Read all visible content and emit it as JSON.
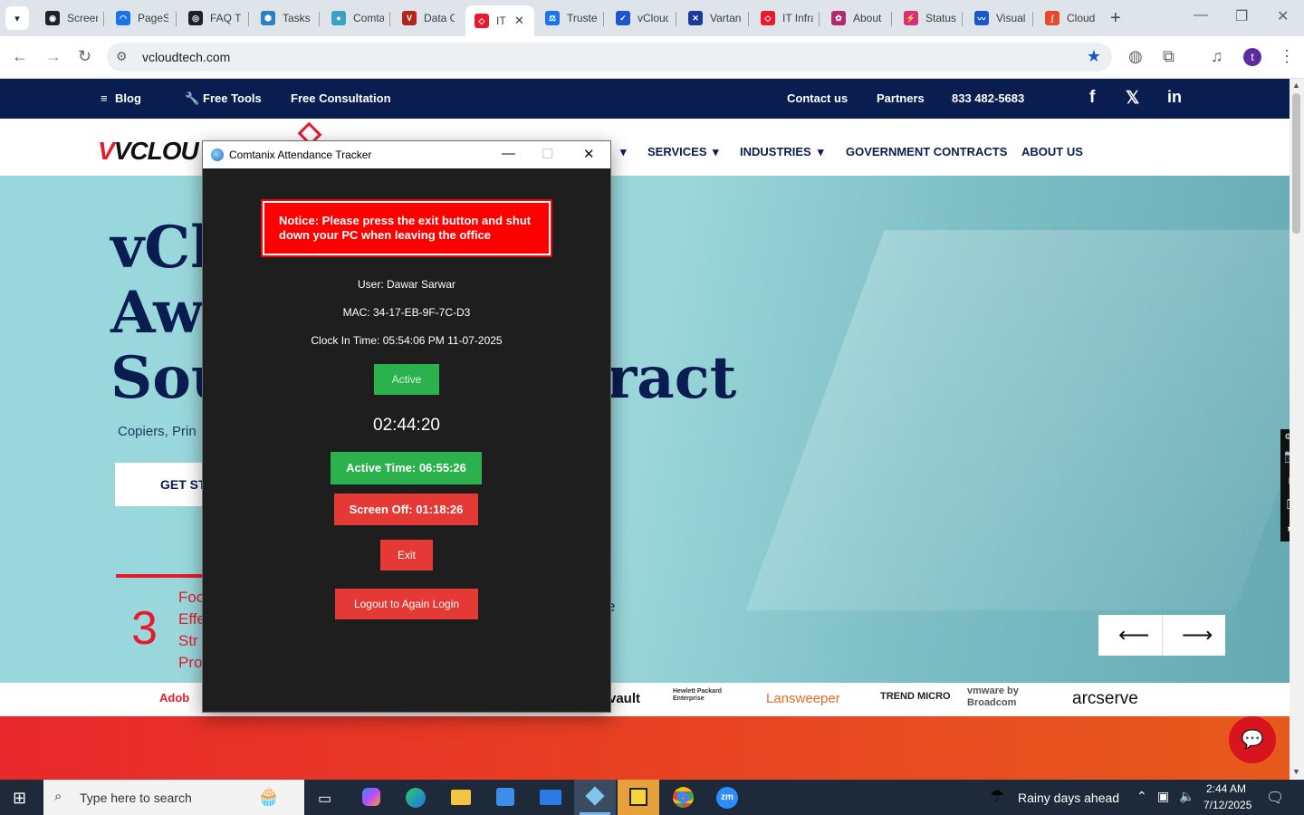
{
  "browser": {
    "tabs": [
      {
        "label": "Screen",
        "color": "#202124",
        "glyph": "◉"
      },
      {
        "label": "PageSpeed",
        "color": "#1a73e8",
        "glyph": "◠"
      },
      {
        "label": "FAQ T",
        "color": "#202124",
        "glyph": "◎"
      },
      {
        "label": "Tasks",
        "color": "#2b7fc3",
        "glyph": "⬢"
      },
      {
        "label": "Comtanix",
        "color": "#3aa0c8",
        "glyph": "●"
      },
      {
        "label": "Data C",
        "color": "#b3261e",
        "glyph": "V"
      },
      {
        "label": "IT",
        "color": "#e8192c",
        "glyph": "◇",
        "active": true
      },
      {
        "label": "Truste",
        "color": "#1a73e8",
        "glyph": "⚖"
      },
      {
        "label": "vCloud",
        "color": "#1a57c9",
        "glyph": "✓"
      },
      {
        "label": "Vartan",
        "color": "#1a3a9e",
        "glyph": "✕"
      },
      {
        "label": "IT Infra",
        "color": "#e8192c",
        "glyph": "◇"
      },
      {
        "label": "About",
        "color": "#b0286e",
        "glyph": "✿"
      },
      {
        "label": "Status",
        "color": "#d62e7a",
        "glyph": "⚡"
      },
      {
        "label": "Visual",
        "color": "#1a57c9",
        "glyph": "〰"
      },
      {
        "label": "Cloud",
        "color": "#e8492a",
        "glyph": "∫"
      }
    ],
    "url": "vcloudtech.com",
    "profile_initial": "t"
  },
  "site": {
    "topbar": {
      "blog": "Blog",
      "free_tools": "Free Tools",
      "free_consultation": "Free Consultation",
      "contact": "Contact us",
      "partners": "Partners",
      "phone": "833 482-5683"
    },
    "logo": "VCLOU",
    "nav": {
      "services": "SERVICES",
      "industries": "INDUSTRIES",
      "government": "GOVERNMENT CONTRACTS",
      "about": "ABOUT US"
    },
    "hero": {
      "line1": "vCl",
      "line2": "Aw",
      "line3a": "Sou",
      "line3b": "tract",
      "subtitle": "Copiers, Prin",
      "button": "GET ST",
      "stat_number": "3",
      "stat_lines": [
        "Foc",
        "Effe",
        "Str",
        "Pro"
      ],
      "stat_tail": "e"
    },
    "partner_logos": [
      "Adob",
      "vault",
      "Hewlett Packard Enterprise",
      "Lansweeper",
      "TREND MICRO",
      "vmware by Broadcom",
      "arcserve"
    ]
  },
  "app": {
    "title": "Comtanix Attendance Tracker",
    "notice": "Notice: Please press the exit button and shut down your PC when leaving the office",
    "user": "User: Dawar Sarwar",
    "mac": "MAC: 34-17-EB-9F-7C-D3",
    "clock_in": "Clock In Time: 05:54:06 PM 11-07-2025",
    "status": "Active",
    "timer": "02:44:20",
    "active_time": "Active Time: 06:55:26",
    "screen_off": "Screen Off: 01:18:26",
    "exit": "Exit",
    "logout": "Logout to Again Login"
  },
  "taskbar": {
    "search_placeholder": "Type here to search",
    "weather": "Rainy days ahead",
    "time": "2:44 AM",
    "date": "7/12/2025",
    "apps": [
      "task-view",
      "copilot",
      "edge",
      "file-explorer",
      "store",
      "mail",
      "comtanix",
      "sticky-notes",
      "chrome",
      "zoom"
    ]
  },
  "colors": {
    "navy": "#0a1d50",
    "brand_red": "#e8192c",
    "active_green": "#2bb24c",
    "button_red": "#e53935",
    "notice_red": "#ff0000"
  }
}
